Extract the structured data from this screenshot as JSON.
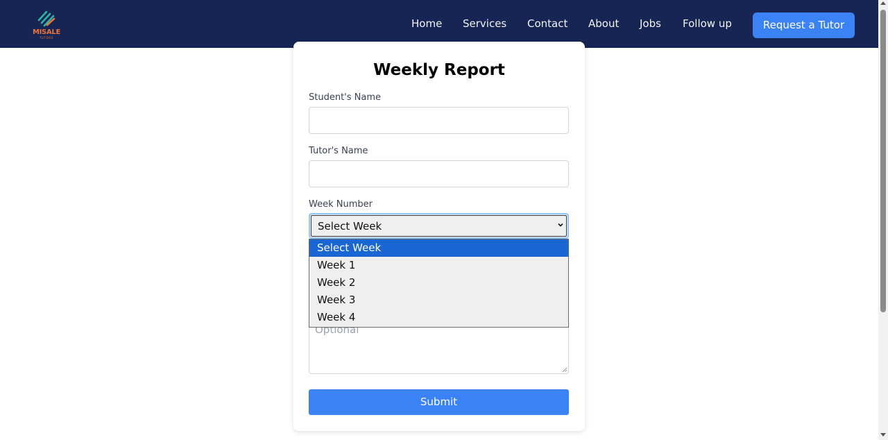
{
  "brand": {
    "name": "MISALE",
    "sub": "TUTORS",
    "accent": "#e8743b",
    "stripe_color": "#2fb5a5"
  },
  "nav": {
    "links": [
      "Home",
      "Services",
      "Contact",
      "About",
      "Jobs",
      "Follow up"
    ],
    "cta": "Request a Tutor",
    "background": "#172554"
  },
  "form": {
    "title": "Weekly Report",
    "student_label": "Student's Name",
    "student_value": "",
    "tutor_label": "Tutor's Name",
    "tutor_value": "",
    "week_label": "Week Number",
    "week_selected": "Select Week",
    "week_options": [
      "Select Week",
      "Week 1",
      "Week 2",
      "Week 3",
      "Week 4"
    ],
    "notes_placeholder": "Optional",
    "submit_label": "Submit",
    "accent": "#3b82f6"
  },
  "icons": {
    "select_arrow": "chevron-down-icon",
    "resize": "resize-handle-icon"
  }
}
